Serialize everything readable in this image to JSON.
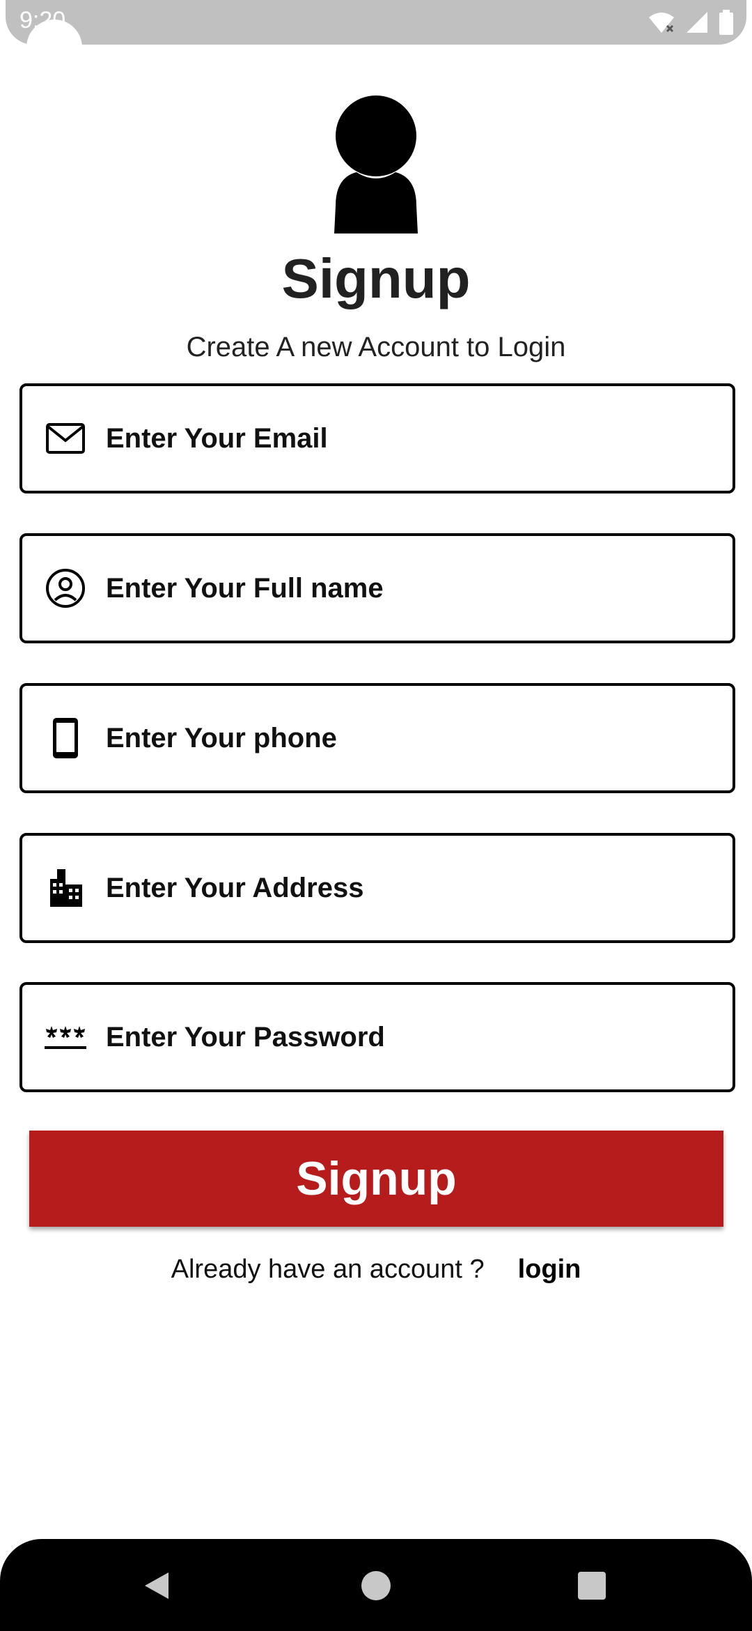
{
  "status_bar": {
    "time": "9:20",
    "icons": [
      "wifi-off-icon",
      "signal-icon",
      "battery-icon"
    ]
  },
  "header": {
    "avatar_icon": "person-icon",
    "title": "Signup",
    "subtitle": "Create A new Account to Login"
  },
  "form": {
    "fields": [
      {
        "icon": "mail-icon",
        "placeholder": "Enter Your Email"
      },
      {
        "icon": "account-circle-icon",
        "placeholder": "Enter Your Full name"
      },
      {
        "icon": "phone-icon",
        "placeholder": "Enter Your phone"
      },
      {
        "icon": "building-icon",
        "placeholder": "Enter Your Address"
      },
      {
        "icon": "password-icon",
        "placeholder": "Enter Your Password"
      }
    ],
    "submit_label": "Signup"
  },
  "footer": {
    "prompt": "Already have an account ?",
    "login_label": "login"
  },
  "nav_bar": {
    "icons": [
      "back-icon",
      "home-icon",
      "recents-icon"
    ]
  },
  "colors": {
    "primary": "#b71c1c",
    "text": "#212121",
    "status_bar": "#c0c0c0",
    "nav_bar": "#000000"
  }
}
